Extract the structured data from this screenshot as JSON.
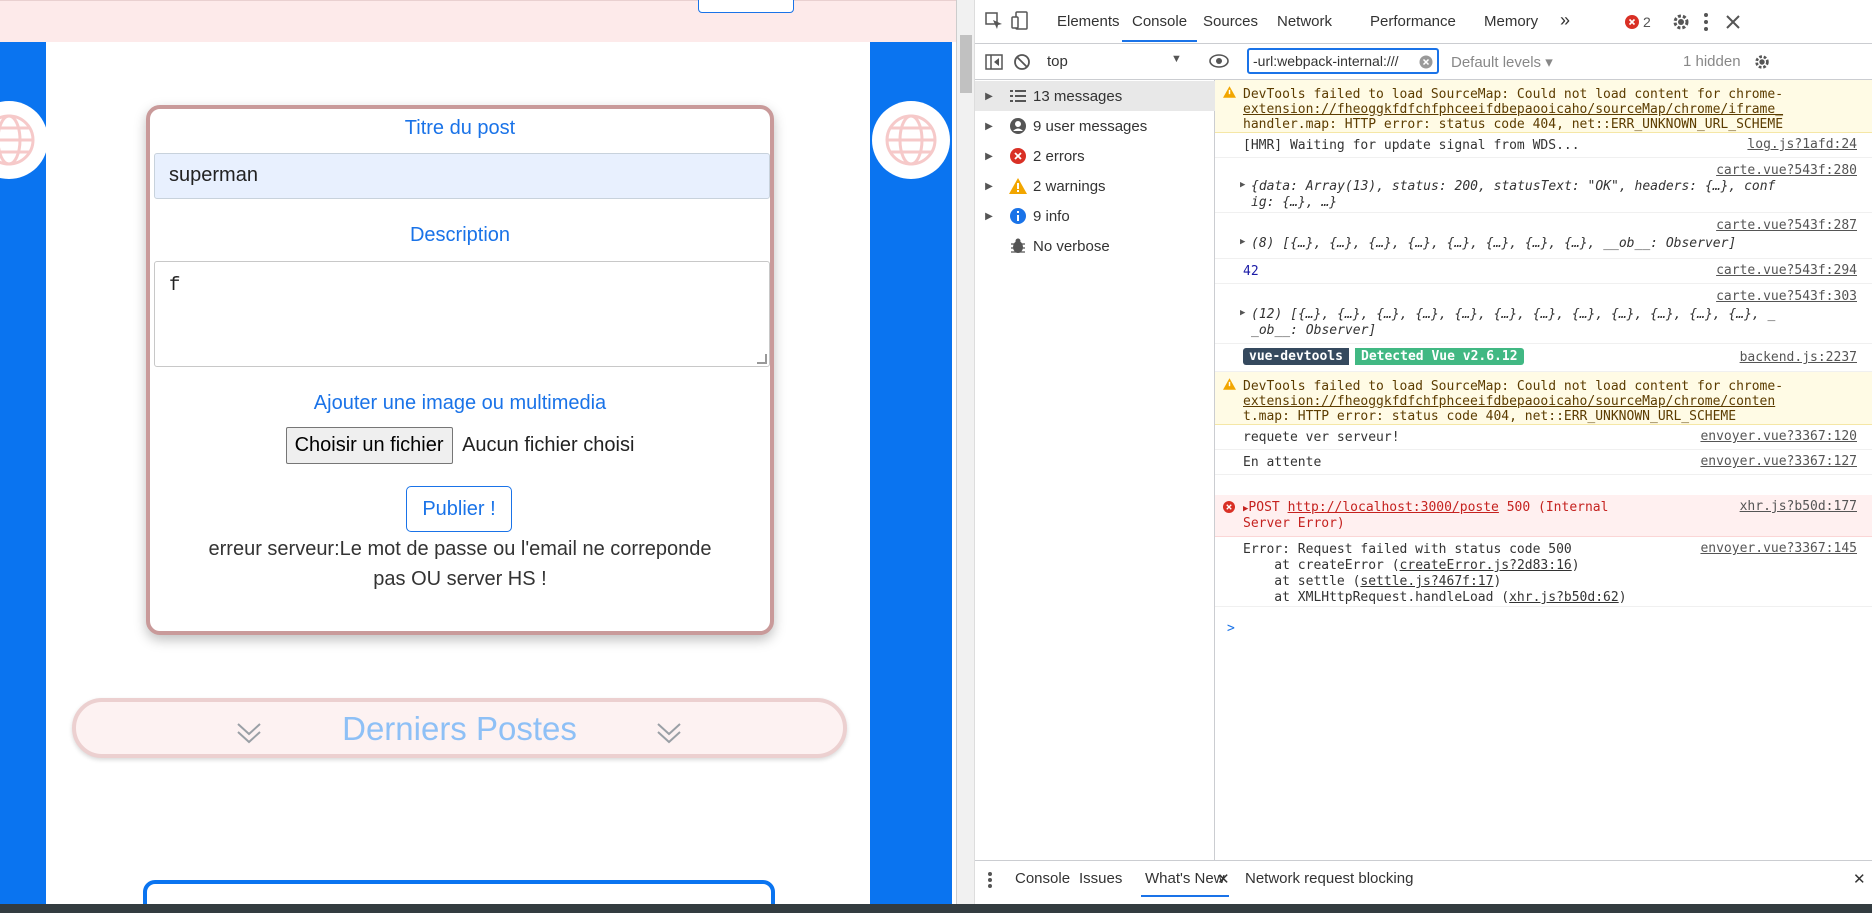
{
  "app": {
    "form": {
      "title_label": "Titre du post",
      "title_value": "superman",
      "description_label": "Description",
      "description_value": "f",
      "media_label": "Ajouter une image ou multimedia",
      "file_button": "Choisir un fichier",
      "file_status": "Aucun fichier choisi",
      "publish_button": "Publier !",
      "error_message": "erreur serveur:Le mot de passe ou l'email ne correponde pas OU server HS !"
    },
    "latest_title": "Derniers Postes"
  },
  "devtools": {
    "tabs": [
      "Elements",
      "Console",
      "Sources",
      "Network",
      "Performance",
      "Memory"
    ],
    "active_tab": "Console",
    "more_tabs": "»",
    "error_count": "2",
    "context": "top",
    "filter_value": "-url:webpack-internal:///",
    "levels": "Default levels ▾",
    "hidden": "1 hidden",
    "sidebar": [
      {
        "label": "13 messages",
        "icon": "list-icon",
        "color": "#555555"
      },
      {
        "label": "9 user messages",
        "icon": "user-icon",
        "color": "#555555"
      },
      {
        "label": "2 errors",
        "icon": "error-icon",
        "color": "#d93025"
      },
      {
        "label": "2 warnings",
        "icon": "warning-icon",
        "color": "#f2a600"
      },
      {
        "label": "9 info",
        "icon": "info-icon",
        "color": "#1a73e8"
      },
      {
        "label": "No verbose",
        "icon": "bug-icon",
        "color": "#555555"
      }
    ],
    "messages": {
      "m1": {
        "l1": "DevTools failed to load SourceMap: Could not load content for chrome-",
        "l2": "extension://fheoggkfdfchfphceeifdbepaooicaho/sourceMap/chrome/iframe_",
        "l3": "handler.map: HTTP error: status code 404, net::ERR_UNKNOWN_URL_SCHEME"
      },
      "m2": {
        "text": "[HMR] Waiting for update signal from WDS...",
        "src": "log.js?1afd:24"
      },
      "m3": {
        "src": "carte.vue?543f:280",
        "l1": "{data: Array(13), status: 200, statusText: \"OK\", headers: {…}, conf",
        "l2": "ig: {…}, …}"
      },
      "m4": {
        "src": "carte.vue?543f:287",
        "text": "(8) [{…}, {…}, {…}, {…}, {…}, {…}, {…}, {…}, __ob__: Observer]"
      },
      "m5": {
        "text": "42",
        "src": "carte.vue?543f:294"
      },
      "m6": {
        "src": "carte.vue?543f:303",
        "l1": "(12) [{…}, {…}, {…}, {…}, {…}, {…}, {…}, {…}, {…}, {…}, {…}, {…}, _",
        "l2": "_ob__: Observer]"
      },
      "m7": {
        "badge1": "vue-devtools",
        "badge2": "Detected Vue v2.6.12",
        "src": "backend.js:2237"
      },
      "m8": {
        "l1": "DevTools failed to load SourceMap: Could not load content for chrome-",
        "l2": "extension://fheoggkfdfchfphceeifdbepaooicaho/sourceMap/chrome/conten",
        "l3": "t.map: HTTP error: status code 404, net::ERR_UNKNOWN_URL_SCHEME"
      },
      "m9": {
        "text": "requete ver serveur!",
        "src": "envoyer.vue?3367:120"
      },
      "m10": {
        "text": "En attente",
        "src": "envoyer.vue?3367:127"
      },
      "m11": {
        "method": "POST",
        "url": "http://localhost:3000/poste",
        "status": "500 (Internal",
        "l2": "Server Error)",
        "src": "xhr.js?b50d:177"
      },
      "m12": {
        "l1": "Error: Request failed with status code 500",
        "src": "envoyer.vue?3367:145",
        "l2a": "    at createError (",
        "l2b": "createError.js?2d83:16",
        "l3a": "    at settle (",
        "l3b": "settle.js?467f:17",
        "l4a": "    at XMLHttpRequest.handleLoad (",
        "l4b": "xhr.js?b50d:62"
      },
      "prompt": ">"
    },
    "bottom_tabs": [
      "Console",
      "Issues",
      "What's New",
      "Network request blocking"
    ],
    "bottom_active": "What's New"
  }
}
